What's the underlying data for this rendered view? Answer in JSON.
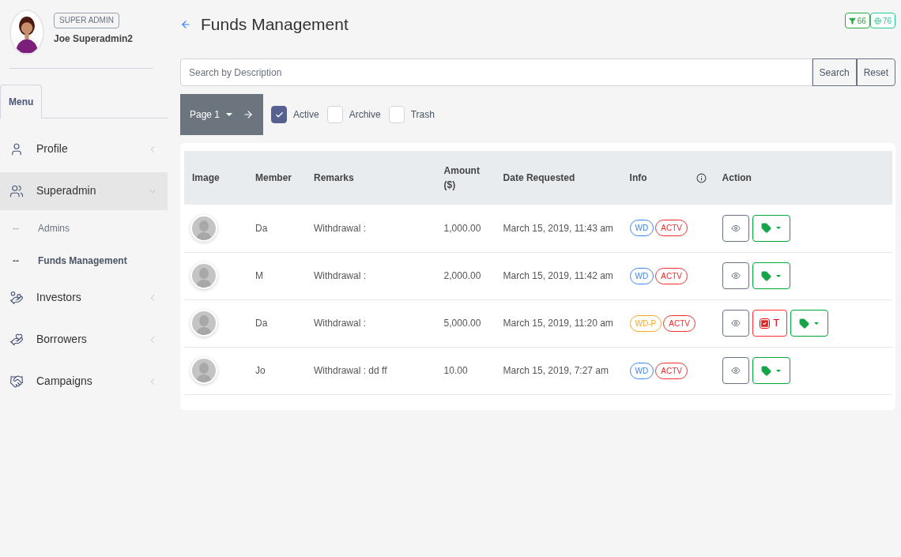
{
  "user": {
    "role": "SUPER ADMIN",
    "name": "Joe Superadmin2"
  },
  "menu_tab": "Menu",
  "sidebar": {
    "items": [
      {
        "label": "Profile",
        "expanded": false,
        "selected": false
      },
      {
        "label": "Superadmin",
        "expanded": true,
        "selected": true,
        "children": [
          {
            "marker": "--",
            "label": "Admins",
            "selected": false
          },
          {
            "marker": "--",
            "label": "Funds Management",
            "selected": true
          }
        ]
      },
      {
        "label": "Investors",
        "expanded": false,
        "selected": false
      },
      {
        "label": "Borrowers",
        "expanded": false,
        "selected": false
      },
      {
        "label": "Campaigns",
        "expanded": false,
        "selected": false
      }
    ]
  },
  "page": {
    "title": "Funds Management"
  },
  "badges": [
    {
      "kind": "filter",
      "label": "66",
      "color": "#28a745"
    },
    {
      "kind": "globe",
      "label": "76",
      "color": "#20c997"
    }
  ],
  "search": {
    "placeholder": "Search by Description",
    "buttons": [
      "Search",
      "Reset"
    ]
  },
  "pager": {
    "label": "Page 1"
  },
  "filters": [
    {
      "label": "Active",
      "checked": true
    },
    {
      "label": "Archive",
      "checked": false
    },
    {
      "label": "Trash",
      "checked": false
    }
  ],
  "table": {
    "columns": [
      "Image",
      "Member",
      "Remarks",
      "Amount ($)",
      "Date Requested",
      "Info",
      "Action"
    ],
    "rows": [
      {
        "member": "Da",
        "remarks": "Withdrawal :",
        "amount": "1,000.00",
        "date": "March 15, 2019, 11:43 am",
        "tags": [
          {
            "label": "WD",
            "color": "#3b82f6"
          },
          {
            "label": "ACTV",
            "color": "#ef2b2b"
          }
        ],
        "actions": [
          {
            "kind": "view"
          },
          {
            "kind": "tag"
          }
        ]
      },
      {
        "member": "M",
        "remarks": "Withdrawal :",
        "amount": "2,000.00",
        "date": "March 15, 2019, 11:42 am",
        "tags": [
          {
            "label": "WD",
            "color": "#3b82f6"
          },
          {
            "label": "ACTV",
            "color": "#ef2b2b"
          }
        ],
        "actions": [
          {
            "kind": "view"
          },
          {
            "kind": "tag"
          }
        ]
      },
      {
        "member": "Da",
        "remarks": "Withdrawal :",
        "amount": "5,000.00",
        "date": "March 15, 2019, 11:20 am",
        "tags": [
          {
            "label": "WD-P",
            "color": "#f5a623"
          },
          {
            "label": "ACTV",
            "color": "#ef2b2b"
          }
        ],
        "actions": [
          {
            "kind": "view"
          },
          {
            "kind": "trash",
            "label": "T"
          },
          {
            "kind": "tag"
          }
        ]
      },
      {
        "member": "Jo",
        "remarks": "Withdrawal : dd ff",
        "amount": "10.00",
        "date": "March 15, 2019, 7:27 am",
        "tags": [
          {
            "label": "WD",
            "color": "#3b82f6"
          },
          {
            "label": "ACTV",
            "color": "#ef2b2b"
          }
        ],
        "actions": [
          {
            "kind": "view"
          },
          {
            "kind": "tag"
          }
        ]
      }
    ]
  }
}
